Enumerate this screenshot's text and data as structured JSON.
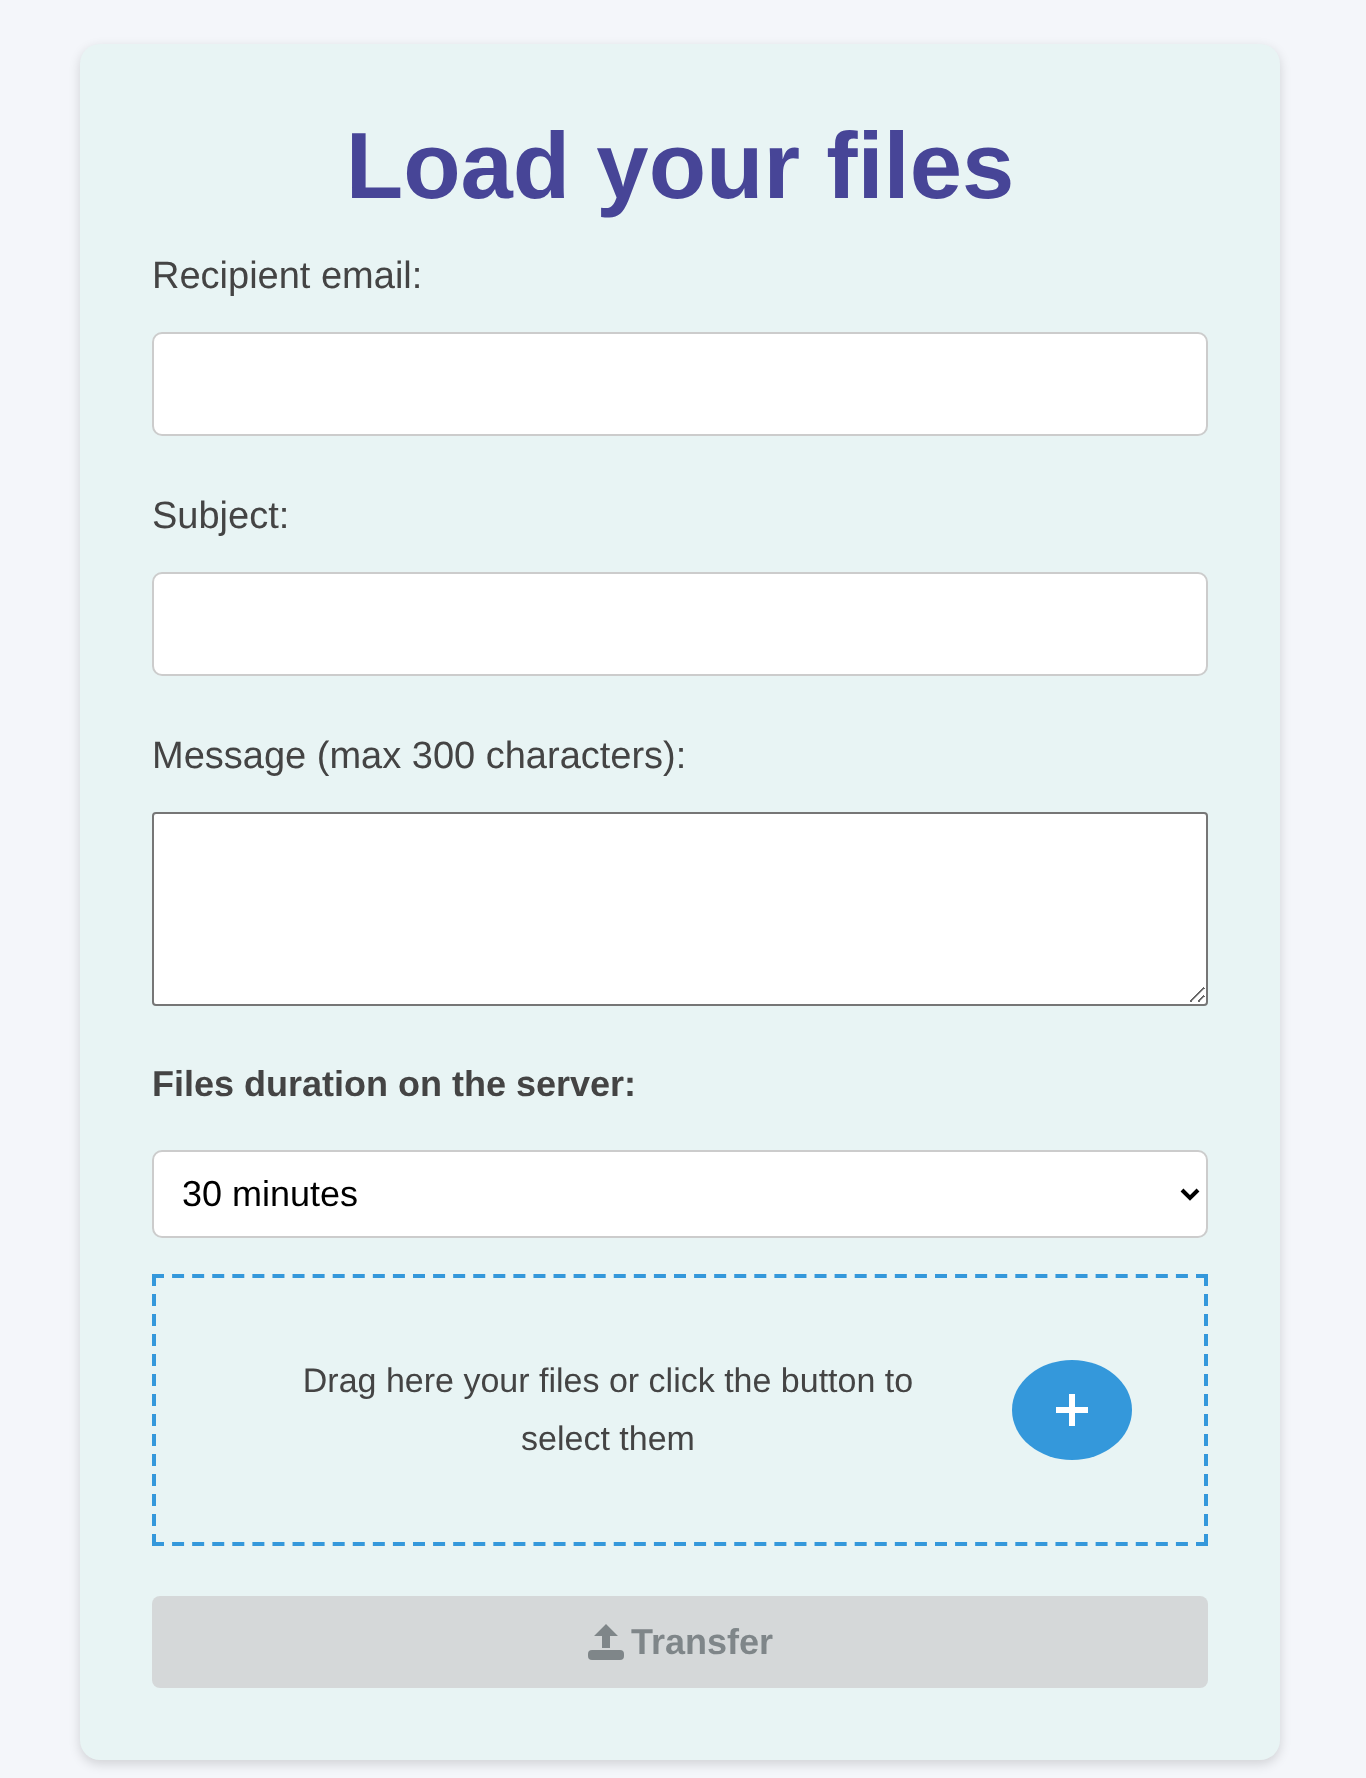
{
  "title": "Load your files",
  "fields": [
    {
      "kind": "input",
      "label": "Recipient email:"
    },
    {
      "kind": "input",
      "label": "Subject:"
    },
    {
      "kind": "textarea",
      "label": "Message (max 300 characters):"
    }
  ],
  "duration": {
    "label": "Files duration on the server:",
    "value": "30 minutes"
  },
  "dropzone": {
    "text": "Drag here your files or click the button to select them"
  },
  "transfer_button": {
    "label": "Transfer",
    "disabled": true
  }
}
